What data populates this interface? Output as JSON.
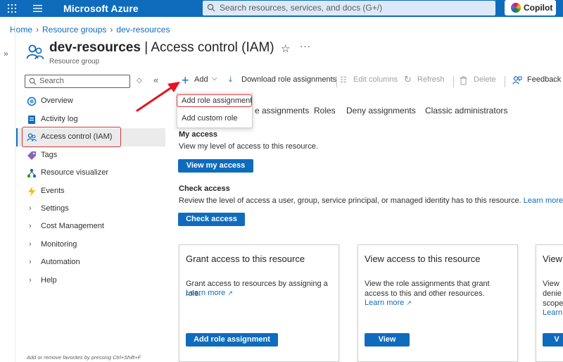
{
  "topbar": {
    "brand": "Microsoft Azure",
    "search_placeholder": "Search resources, services, and docs (G+/)",
    "copilot_label": "Copilot",
    "bg_color": "#0f6cbd"
  },
  "breadcrumb": {
    "items": [
      "Home",
      "Resource groups",
      "dev-resources"
    ]
  },
  "page": {
    "resource_name": "dev-resources",
    "title_suffix": "| Access control (IAM)",
    "subtitle": "Resource group"
  },
  "sidebar": {
    "search_placeholder": "Search",
    "items": [
      {
        "label": "Overview",
        "icon": "overview-icon"
      },
      {
        "label": "Activity log",
        "icon": "activity-log-icon"
      },
      {
        "label": "Access control (IAM)",
        "icon": "people-icon",
        "selected": true
      },
      {
        "label": "Tags",
        "icon": "tag-icon"
      },
      {
        "label": "Resource visualizer",
        "icon": "visualizer-icon"
      },
      {
        "label": "Events",
        "icon": "lightning-icon"
      },
      {
        "label": "Settings",
        "icon": "chevron-right-icon"
      },
      {
        "label": "Cost Management",
        "icon": "chevron-right-icon"
      },
      {
        "label": "Monitoring",
        "icon": "chevron-right-icon"
      },
      {
        "label": "Automation",
        "icon": "chevron-right-icon"
      },
      {
        "label": "Help",
        "icon": "chevron-right-icon"
      }
    ],
    "footer": "Add or remove favorites by pressing Ctrl+Shift+F"
  },
  "toolbar": {
    "add": "Add",
    "download": "Download role assignments",
    "edit_columns": "Edit columns",
    "refresh": "Refresh",
    "delete": "Delete",
    "feedback": "Feedback"
  },
  "add_menu": {
    "items": [
      "Add role assignment",
      "Add custom role"
    ]
  },
  "tabs": {
    "role_assignments_partial": "e assignments",
    "roles": "Roles",
    "deny": "Deny assignments",
    "classic": "Classic administrators"
  },
  "my_access": {
    "title": "My access",
    "desc": "View my level of access to this resource.",
    "button": "View my access"
  },
  "check_access": {
    "title": "Check access",
    "desc": "Review the level of access a user, group, service principal, or managed identity has to this resource.",
    "link": "Learn more",
    "button": "Check access"
  },
  "cards": [
    {
      "title": "Grant access to this resource",
      "desc": "Grant access to resources by assigning a role.",
      "link": "Learn more",
      "button": "Add role assignment"
    },
    {
      "title": "View access to this resource",
      "desc": "View the role assignments that grant access to this and other resources.",
      "link": "Learn more",
      "button": "View"
    },
    {
      "title": "View",
      "desc_lines": [
        "View",
        "denie",
        "scope."
      ],
      "link": "Learn",
      "button": "V"
    }
  ],
  "colors": {
    "accent": "#0f6cbd",
    "highlight": "#d13438"
  }
}
